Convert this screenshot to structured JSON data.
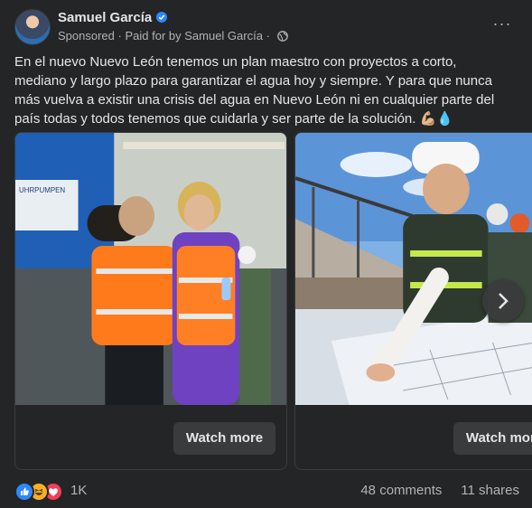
{
  "post": {
    "author": "Samuel García",
    "sponsored_label": "Sponsored",
    "paid_for": "Paid for by Samuel García",
    "separator": "·",
    "more_icon": "···",
    "text": "En el nuevo Nuevo León tenemos un plan maestro con proyectos a corto, mediano y largo plazo para garantizar el agua hoy y siempre. Y para que nunca más vuelva a existir una crisis del agua en Nuevo León ni en cualquier parte del país todas y todos tenemos que cuidarla y ser parte de la solución.",
    "emojis": "💪🏼💧"
  },
  "carousel": {
    "cards": [
      {
        "photo_text": "UHRPUMPEN",
        "button_label": "Watch more"
      },
      {
        "button_label": "Watch more"
      }
    ]
  },
  "footer": {
    "reaction_count": "1K",
    "comments": "48 comments",
    "shares": "11 shares"
  },
  "colors": {
    "background": "#242526",
    "text": "#e4e6eb",
    "secondary_text": "#b0b3b8",
    "button": "#3a3b3c",
    "verified": "#2d88ff"
  },
  "icons": [
    "avatar",
    "verified-badge-icon",
    "globe-icon",
    "more-options-icon",
    "chevron-right-icon",
    "like-reaction-icon",
    "haha-reaction-icon",
    "love-reaction-icon"
  ]
}
